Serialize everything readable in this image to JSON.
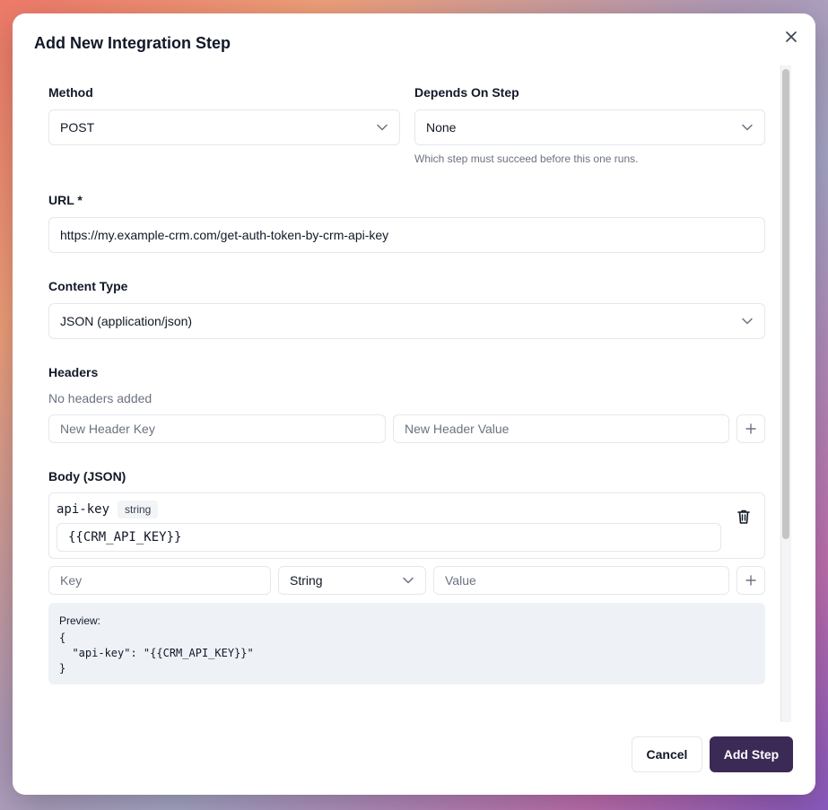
{
  "dialog": {
    "title": "Add New Integration Step",
    "close_icon": "close-icon"
  },
  "method": {
    "label": "Method",
    "value": "POST"
  },
  "depends_on": {
    "label": "Depends On Step",
    "value": "None",
    "helper": "Which step must succeed before this one runs."
  },
  "url": {
    "label": "URL *",
    "value": "https://my.example-crm.com/get-auth-token-by-crm-api-key"
  },
  "content_type": {
    "label": "Content Type",
    "value": "JSON (application/json)"
  },
  "headers": {
    "label": "Headers",
    "empty_text": "No headers added",
    "key_placeholder": "New Header Key",
    "value_placeholder": "New Header Value"
  },
  "body": {
    "label": "Body (JSON)",
    "entries": [
      {
        "key": "api-key",
        "type": "string",
        "value": "{{CRM_API_KEY}}"
      }
    ],
    "new_key_placeholder": "Key",
    "new_type_value": "String",
    "new_value_placeholder": "Value",
    "preview_title": "Preview:",
    "preview_text": "{\n  \"api-key\": \"{{CRM_API_KEY}}\"\n}"
  },
  "footer": {
    "cancel_label": "Cancel",
    "submit_label": "Add Step"
  },
  "colors": {
    "primary": "#3b2a55",
    "border": "#e5e7eb",
    "preview_bg": "#eef2f7"
  }
}
